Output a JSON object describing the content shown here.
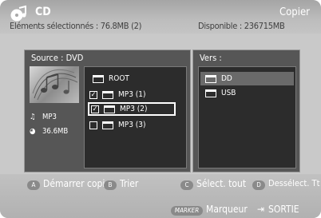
{
  "header": {
    "title": "CD",
    "mode": "Copier",
    "selected_elements": "Eléments sélectionnés : 76.8MB  (2)",
    "available": "Disponible : 236715MB"
  },
  "source_panel": {
    "label": "Source : DVD",
    "media_type": "MP3",
    "media_size": "36.6MB",
    "tree": {
      "root": "ROOT",
      "items": [
        {
          "label": "MP3 (1)",
          "checked": true
        },
        {
          "label": "MP3 (2)",
          "checked": true,
          "selected": true
        },
        {
          "label": "MP3 (3)",
          "checked": false
        }
      ]
    }
  },
  "destination_panel": {
    "label": "Vers :",
    "items": [
      {
        "label": "DD",
        "highlighted": true
      },
      {
        "label": "USB",
        "highlighted": false
      }
    ]
  },
  "footer": {
    "buttons": [
      {
        "key": "A",
        "label": "Démarrer copie"
      },
      {
        "key": "B",
        "label": "Trier"
      },
      {
        "key": "C",
        "label": "Sélect. tout"
      },
      {
        "key": "D",
        "label": "Dessélect. Tt"
      }
    ],
    "marker_key": "MARKER",
    "marker_label": "Marqueur",
    "exit_label": "SORTIE"
  },
  "colors": {
    "panel_bg": "#565656",
    "list_bg": "#2c2c2c",
    "screen_bg": "#c9c9c9",
    "highlight": "#6a6a6a"
  }
}
